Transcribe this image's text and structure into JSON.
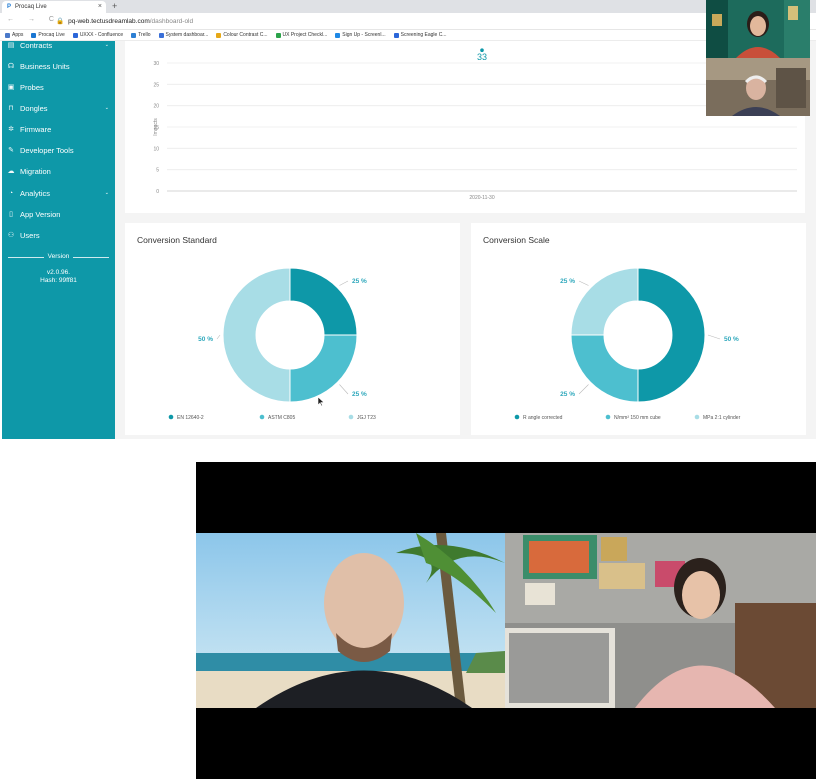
{
  "browser": {
    "tab_title": "Procaq Live",
    "tab_favicon": "P",
    "tab_close": "×",
    "new_tab": "+",
    "nav_buttons": "← → C",
    "url_prefix": "pq-web.tectusdreamlab.com",
    "url_path": "/dashboard-old",
    "bookmarks": [
      {
        "label": "Apps",
        "icon": "apps-icon",
        "color": "#4a79c9"
      },
      {
        "label": "Procaq Live",
        "icon": "procaq-icon",
        "color": "#1976d2"
      },
      {
        "label": "UXXX - Confluence",
        "icon": "confluence-icon",
        "color": "#2b66d9"
      },
      {
        "label": "Trello",
        "icon": "trello-icon",
        "color": "#2d7fd3"
      },
      {
        "label": "System dashboar...",
        "icon": "jira-icon",
        "color": "#3a6fd8"
      },
      {
        "label": "Colour Contrast C...",
        "icon": "contrast-icon",
        "color": "#e6a817"
      },
      {
        "label": "UX Project Checkl...",
        "icon": "check-icon",
        "color": "#2ba34a"
      },
      {
        "label": "Sign Up - Screenl...",
        "icon": "screenleap-icon",
        "color": "#1e88e5"
      },
      {
        "label": "Screening Eagle C...",
        "icon": "confluence-icon",
        "color": "#2b66d9"
      }
    ]
  },
  "sidebar": {
    "items": [
      {
        "label": "Contracts",
        "icon": "contracts-icon",
        "glyph": "▤",
        "chevron": "⌄"
      },
      {
        "label": "Business Units",
        "icon": "headset-icon",
        "glyph": "☊",
        "chevron": ""
      },
      {
        "label": "Probes",
        "icon": "probe-icon",
        "glyph": "▣",
        "chevron": ""
      },
      {
        "label": "Dongles",
        "icon": "dongle-icon",
        "glyph": "⊓",
        "chevron": "⌄"
      },
      {
        "label": "Firmware",
        "icon": "gear-icon",
        "glyph": "✲",
        "chevron": ""
      },
      {
        "label": "Developer Tools",
        "icon": "wrench-icon",
        "glyph": "✎",
        "chevron": ""
      },
      {
        "label": "Migration",
        "icon": "cloud-icon",
        "glyph": "☁",
        "chevron": ""
      },
      {
        "label": "Analytics",
        "icon": "analytics-icon",
        "glyph": "◔",
        "chevron": "⌄"
      },
      {
        "label": "App Version",
        "icon": "phone-icon",
        "glyph": "▯",
        "chevron": ""
      },
      {
        "label": "Users",
        "icon": "users-icon",
        "glyph": "⚇",
        "chevron": ""
      }
    ],
    "version_title": "Version",
    "version_number": "v2.0.96.",
    "version_hash": "Hash: 99ff81"
  },
  "impacts_chart": {
    "chart_data": {
      "type": "scatter",
      "ylabel": "Impacts",
      "ylim": [
        0,
        30
      ],
      "yticks": [
        "0",
        "5",
        "10",
        "15",
        "20",
        "25",
        "30"
      ],
      "categories": [
        "2020-11-30"
      ],
      "values": [
        33
      ],
      "data_label": "33",
      "grid": true
    }
  },
  "conversion_standard": {
    "title": "Conversion Standard",
    "chart_data": {
      "type": "pie",
      "labels": [
        "EN 12640-2",
        "ASTM C805",
        "JGJ T23"
      ],
      "values": [
        25,
        25,
        50
      ],
      "value_labels": [
        "25 %",
        "25 %",
        "50 %"
      ],
      "colors": [
        "#0e98a8",
        "#4dbfcf",
        "#a8dde6"
      ],
      "legend_position": "bottom"
    }
  },
  "conversion_scale": {
    "title": "Conversion Scale",
    "chart_data": {
      "type": "pie",
      "labels": [
        "R angle corrected",
        "N/mm² 150 mm cube",
        "MPa 2:1 cylinder"
      ],
      "values": [
        50,
        25,
        25
      ],
      "value_labels": [
        "50 %",
        "25 %",
        "25 %"
      ],
      "colors": [
        "#0e98a8",
        "#4dbfcf",
        "#a8dde6"
      ],
      "legend_position": "bottom"
    }
  },
  "video_call": {
    "participants": [
      "participant-woman-top",
      "participant-man-top",
      "participant-man-beach",
      "participant-woman-hoodie"
    ]
  }
}
